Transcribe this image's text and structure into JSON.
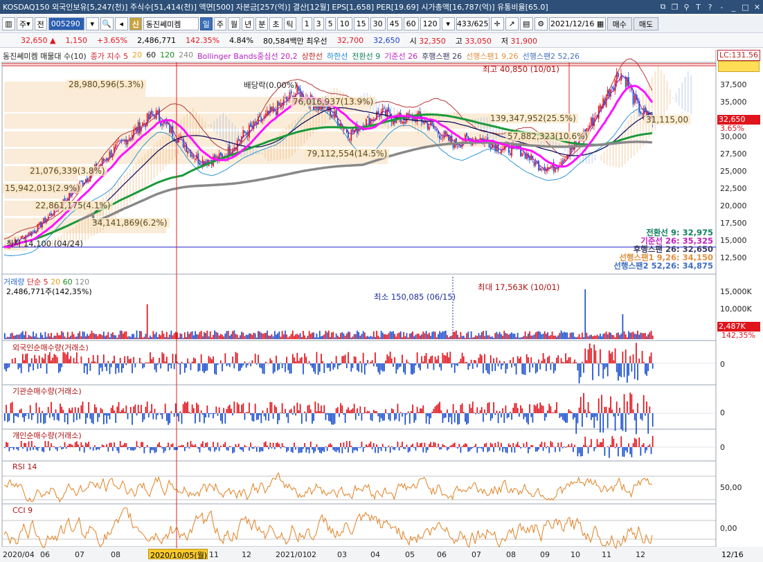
{
  "window": {
    "title": "KOSDAQ150 외국인보유[5,247(천)] 주식수[51,414(천)] 액면[500] 자본금[257(억)] 결산[12월] EPS[1,658] PER[19.69] 시가총액[16,787(억)] 유통비율[65.0]"
  },
  "toolbar": {
    "type_label": "주",
    "period_label": "전",
    "stock_code": "005290",
    "sin_label": "신",
    "stock_name": "동진쎄미켐",
    "periods": [
      "일",
      "주",
      "월",
      "년",
      "분",
      "초",
      "틱"
    ],
    "active_period": "일",
    "intervals": [
      "1",
      "3",
      "5",
      "10",
      "15",
      "30",
      "45",
      "60",
      "120"
    ],
    "count": "433",
    "count_total": "/625",
    "date": "2021/12/16",
    "buy_label": "매수",
    "sell_label": "매도"
  },
  "quote": {
    "price": "32,650",
    "change": "1,150",
    "change_pct": "+3.65%",
    "volume": "2,486,771",
    "volume_ratio": "142.35%",
    "turnover": "4.84%",
    "amount": "80,584백만",
    "priority_label": "최우선",
    "priority_ask": "32,700",
    "priority_bid": "32,650",
    "open_label": "시",
    "open": "32,350",
    "high_label": "고",
    "high": "33,050",
    "low_label": "저",
    "low": "31,900"
  },
  "price_panel": {
    "legend": [
      {
        "text": "동진쎄미켐 매물대 수(10)",
        "color": "#222222"
      },
      {
        "text": "종가 지수 5",
        "color": "#d2232a"
      },
      {
        "text": "20",
        "color": "#e6a020"
      },
      {
        "text": "60",
        "color": "#1a1a1a"
      },
      {
        "text": "120",
        "color": "#1a8a1a"
      },
      {
        "text": "240",
        "color": "#888888"
      },
      {
        "text": "Bollinger Bands중심선 20,2",
        "color": "#b020c0"
      },
      {
        "text": "상한선",
        "color": "#c02020"
      },
      {
        "text": "하한선",
        "color": "#1a8ad0"
      },
      {
        "text": "전환선 9",
        "color": "#108060"
      },
      {
        "text": "기준선 26",
        "color": "#c020c0"
      },
      {
        "text": "후행스팬 26",
        "color": "#3a3a60"
      },
      {
        "text": "선행스팬1 9,26",
        "color": "#e09040"
      },
      {
        "text": "선행스팬2 52,26",
        "color": "#4070c0"
      }
    ],
    "lc_label": "LC:131.56",
    "y_ticks": [
      "37,500",
      "35,000",
      "32,500",
      "30,000",
      "27,500",
      "25,000",
      "22,500",
      "20,000",
      "17,500",
      "15,000",
      "12,500"
    ],
    "price_tag": "32,650",
    "price_tag_pct": "3.65%",
    "annotations": {
      "high": "최고 40,850 (10/01)",
      "low": "최저 14,100 (04/24)",
      "dividend": "배당락(0.00%)",
      "vp1": "28,980,596(5.3%)",
      "vp2": "21,076,339(3.8%)",
      "vp3": "15,942,013(2.9%)",
      "vp4": "22,861,175(4.1%)",
      "vp5": "34,141,869(6.2%)",
      "vp6": "76,016,937(13.9%)",
      "vp7": "79,112,554(14.5%)",
      "vp8": "139,347,952(25.5%)",
      "vp9": "57,882,323(10.6%)",
      "vp10": "31,115,00"
    },
    "ichimoku_values": {
      "conv": "전환선 9: 32,975",
      "base": "기준선 26: 35,325",
      "lag": "후행스팬 26: 32,650",
      "lead1": "선행스팬1 9,26: 34,150",
      "lead2": "선행스팬2 52,26: 34,875"
    }
  },
  "volume_panel": {
    "legend_title": "거래량",
    "legend_ma": "단순 5",
    "legend_20": "20",
    "legend_60": "60",
    "legend_120": "120",
    "current": "2,486,771주(142,35%)",
    "min_label": "최소 150,085 (06/15)",
    "max_label": "최대 17,563K (10/01)",
    "y_ticks": [
      "15,000K",
      "10,000K",
      "5,000K"
    ],
    "tag": "2,487K",
    "tag_pct": "142,35%"
  },
  "panels": {
    "foreign": "외국인순매수량(거래소)",
    "inst": "기관순매수량(거래소)",
    "indiv": "개인순매수량(거래소)",
    "rsi": "RSI 14",
    "cci": "CCI 9",
    "zero": "0",
    "rsi_tick": "50,00",
    "cci_tick": "0,00"
  },
  "x_axis": {
    "labels": [
      "2020/04",
      "06",
      "07",
      "08",
      "09",
      "11",
      "12",
      "2021/01",
      "02",
      "03",
      "04",
      "05",
      "06",
      "07",
      "08",
      "09",
      "10",
      "11",
      "12"
    ],
    "cursor_date": "2020/10/05(월)",
    "end_date": "12/16"
  },
  "colors": {
    "up": "#e0141c",
    "down": "#1b4fd0",
    "ma5": "#d2232a",
    "ma20": "#e6a020",
    "ma60": "#101060",
    "ma120": "#1a9a3a",
    "ma240": "#888888",
    "bb_mid": "#ff10ff"
  }
}
